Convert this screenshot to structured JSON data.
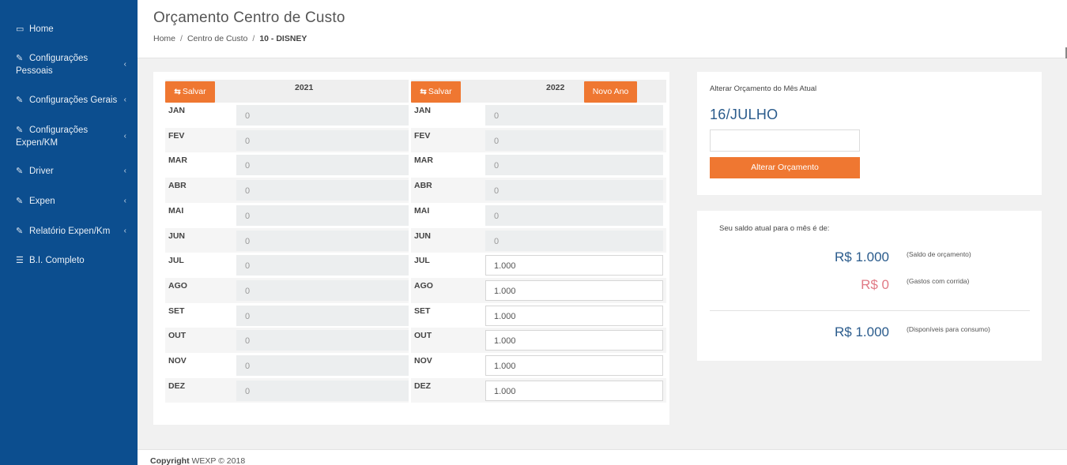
{
  "sidebar": {
    "items": [
      {
        "icon": "laptop-icon",
        "label": "Home",
        "has_chevron": false
      },
      {
        "icon": "edit-icon",
        "label": "Configurações Pessoais",
        "has_chevron": true
      },
      {
        "icon": "edit-icon",
        "label": "Configurações Gerais",
        "has_chevron": true
      },
      {
        "icon": "edit-icon",
        "label": "Configurações Expen/KM",
        "has_chevron": true
      },
      {
        "icon": "edit-icon",
        "label": "Driver",
        "has_chevron": true
      },
      {
        "icon": "edit-icon",
        "label": "Expen",
        "has_chevron": true
      },
      {
        "icon": "edit-icon",
        "label": "Relatório Expen/Km",
        "has_chevron": true
      },
      {
        "icon": "list-icon",
        "label": "B.I. Completo",
        "has_chevron": false
      }
    ],
    "chevron": "‹"
  },
  "header": {
    "title": "Orçamento Centro de Custo",
    "breadcrumb": {
      "home": "Home",
      "section": "Centro de Custo",
      "current": "10 - DISNEY",
      "separator": "/"
    }
  },
  "budget": {
    "save_label": "Salvar",
    "new_year_label": "Novo Ano",
    "years": [
      {
        "year": "2021",
        "months": [
          {
            "month": "JAN",
            "value": "0",
            "editable": false
          },
          {
            "month": "FEV",
            "value": "0",
            "editable": false
          },
          {
            "month": "MAR",
            "value": "0",
            "editable": false
          },
          {
            "month": "ABR",
            "value": "0",
            "editable": false
          },
          {
            "month": "MAI",
            "value": "0",
            "editable": false
          },
          {
            "month": "JUN",
            "value": "0",
            "editable": false
          },
          {
            "month": "JUL",
            "value": "0",
            "editable": false
          },
          {
            "month": "AGO",
            "value": "0",
            "editable": false
          },
          {
            "month": "SET",
            "value": "0",
            "editable": false
          },
          {
            "month": "OUT",
            "value": "0",
            "editable": false
          },
          {
            "month": "NOV",
            "value": "0",
            "editable": false
          },
          {
            "month": "DEZ",
            "value": "0",
            "editable": false
          }
        ]
      },
      {
        "year": "2022",
        "months": [
          {
            "month": "JAN",
            "value": "0",
            "editable": false
          },
          {
            "month": "FEV",
            "value": "0",
            "editable": false
          },
          {
            "month": "MAR",
            "value": "0",
            "editable": false
          },
          {
            "month": "ABR",
            "value": "0",
            "editable": false
          },
          {
            "month": "MAI",
            "value": "0",
            "editable": false
          },
          {
            "month": "JUN",
            "value": "0",
            "editable": false
          },
          {
            "month": "JUL",
            "value": "1.000",
            "editable": true
          },
          {
            "month": "AGO",
            "value": "1.000",
            "editable": true
          },
          {
            "month": "SET",
            "value": "1.000",
            "editable": true
          },
          {
            "month": "OUT",
            "value": "1.000",
            "editable": true
          },
          {
            "month": "NOV",
            "value": "1.000",
            "editable": true
          },
          {
            "month": "DEZ",
            "value": "1.000",
            "editable": true
          }
        ]
      }
    ]
  },
  "alter": {
    "label": "Alterar Orçamento do Mês Atual",
    "date": "16/JULHO",
    "input_value": "",
    "button": "Alterar Orçamento"
  },
  "saldo": {
    "label": "Seu saldo atual para o mês é de:",
    "items": [
      {
        "value": "R$ 1.000",
        "note": "(Saldo de orçamento)",
        "color": "#2a5b8c"
      },
      {
        "value": "R$ 0",
        "note": "(Gastos com corrida)",
        "color": "#e07a85"
      },
      {
        "value": "R$ 1.000",
        "note": "(Disponíveis para consumo)",
        "color": "#2a5b8c"
      }
    ]
  },
  "footer": {
    "bold": "Copyright",
    "text": "WEXP © 2018"
  },
  "colors": {
    "sidebar": "#0c4e8f",
    "accent": "#ef7731"
  }
}
